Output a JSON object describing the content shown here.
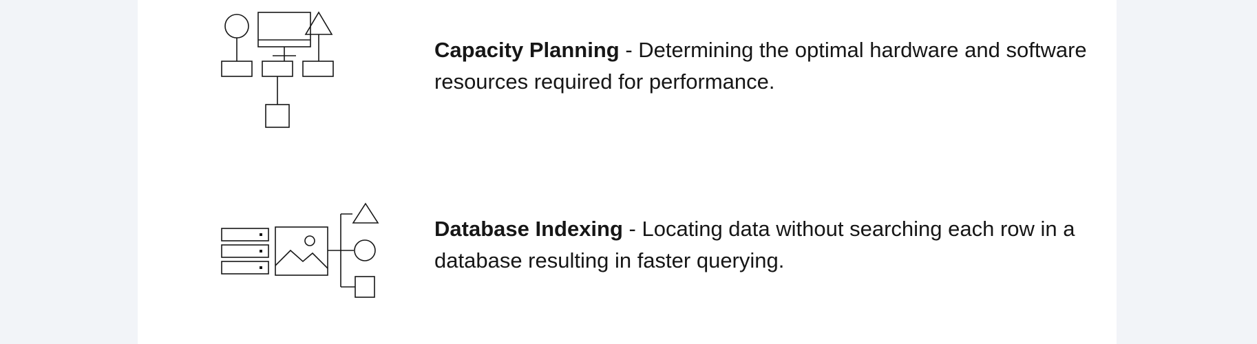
{
  "features": [
    {
      "term": "Capacity Planning",
      "separator": " - ",
      "description": "Determining the optimal hardware and software resources required for performance.",
      "icon": "network-topology-icon"
    },
    {
      "term": "Database Indexing",
      "separator": " - ",
      "description": "Locating data without searching each row in a database resulting in faster querying.",
      "icon": "database-index-icon"
    }
  ],
  "colors": {
    "background": "#f2f4f8",
    "card": "#ffffff",
    "text": "#161616",
    "icon_stroke": "#161616"
  }
}
